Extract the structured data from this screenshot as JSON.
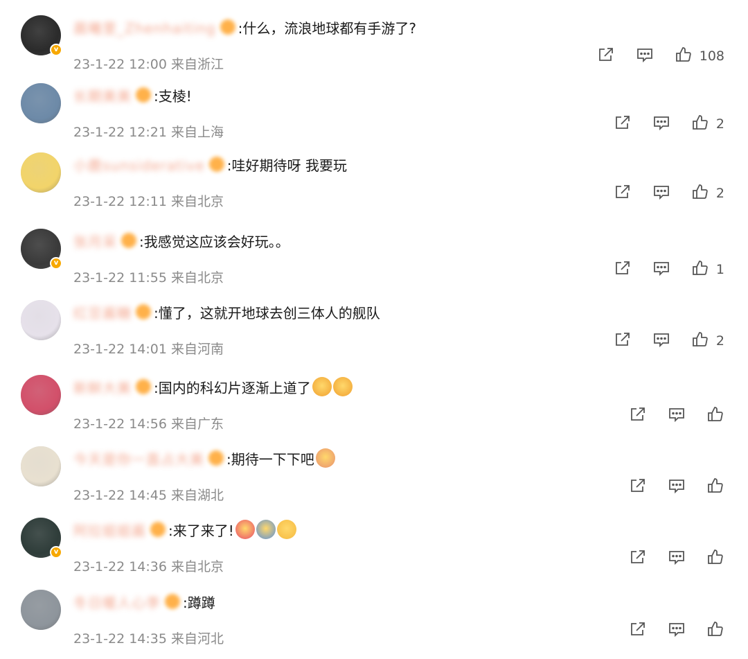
{
  "comments": [
    {
      "user": "晨曦里_Zhenhaiting",
      "text": ":什么，流浪地球都有手游了?",
      "time": "23-1-22 12:00",
      "location": "来自浙江",
      "likes": "108",
      "verified": true,
      "avatar_color": "#2b2b2b"
    },
    {
      "user": "长期美美",
      "text": ":支棱!",
      "time": "23-1-22 12:21",
      "location": "来自上海",
      "likes": "2",
      "verified": false,
      "avatar_color": "#6d8aa8"
    },
    {
      "user": "小鹿sunsiderative",
      "text": ":哇好期待呀 我要玩",
      "time": "23-1-22 12:11",
      "location": "来自北京",
      "likes": "2",
      "verified": false,
      "avatar_color": "#f2d46a"
    },
    {
      "user": "张月采",
      "text": ":我感觉这应该会好玩。。",
      "time": "23-1-22 11:55",
      "location": "来自北京",
      "likes": "1",
      "verified": true,
      "avatar_color": "#3a3a3a"
    },
    {
      "user": "红豆酱糖",
      "text": ":懂了，这就开地球去创三体人的舰队",
      "time": "23-1-22 14:01",
      "location": "来自河南",
      "likes": "2",
      "verified": false,
      "avatar_color": "#e6e1ea"
    },
    {
      "user": "新鲜大美",
      "text": ":国内的科幻片逐渐上道了",
      "time": "23-1-22 14:56",
      "location": "来自广东",
      "likes": "",
      "verified": false,
      "avatar_color": "#d2506a"
    },
    {
      "user": "今天是你一直占大美",
      "text": ":期待一下下吧",
      "time": "23-1-22 14:45",
      "location": "来自湖北",
      "likes": "",
      "verified": false,
      "avatar_color": "#e8e0d0"
    },
    {
      "user": "阿拉姐姐酱",
      "text": ":来了来了!",
      "time": "23-1-22 14:36",
      "location": "来自北京",
      "likes": "",
      "verified": true,
      "avatar_color": "#2f3d3a"
    },
    {
      "user": "冬日暖人心李",
      "text": ":蹲蹲",
      "time": "23-1-22 14:35",
      "location": "来自河北",
      "likes": "",
      "verified": false,
      "avatar_color": "#8e959c"
    }
  ],
  "icons": {
    "share": "share-icon",
    "reply": "reply-icon",
    "like": "like-icon",
    "verified": "verified-badge"
  }
}
